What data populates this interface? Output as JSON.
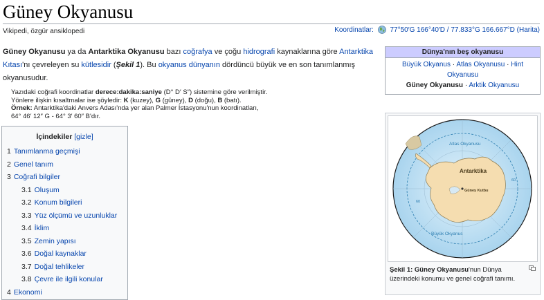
{
  "page": {
    "title": "Güney Okyanusu",
    "tagline": "Vikipedi, özgür ansiklopedi"
  },
  "coordinates": {
    "label": "Koordinatlar:",
    "value": "77°50′G 166°40′D / 77.833°G 166.667°D (Harita)"
  },
  "intro": {
    "t1": "Güney Okyanusu",
    "t2": " ya da ",
    "t3": "Antarktika Okyanusu",
    "t4": " bazı ",
    "l1": "coğrafya",
    "t5": " ve çoğu ",
    "l2": "hidrografi",
    "t6": " kaynaklarına göre ",
    "l3": "Antarktika Kıtası",
    "t7": "'nı çevreleyen su ",
    "l4": "kütlesidir",
    "t8": " (",
    "t9": "Şekil 1",
    "t10": "). Bu ",
    "l5": "okyanus dünyanın",
    "t11": " dördüncü büyük ve en son tanımlanmış okyanusudur."
  },
  "coord_note": {
    "a1": "Yazıdaki coğrafi koordinatlar ",
    "a2": "derece:dakika:saniye",
    "a3": " (D° D′ S″) sistemine göre verilmiştir.",
    "b1": "Yönlere ilişkin kısaltmalar ise şöyledir: ",
    "b2": "K",
    "b3": " (kuzey), ",
    "b4": "G",
    "b5": " (güney), ",
    "b6": "D",
    "b7": " (doğu), ",
    "b8": "B",
    "b9": " (batı).",
    "c1": "Örnek:",
    "c2": " Antarktika'daki Anvers Adası'nda yer alan Palmer İstasyonu'nun koordinatları,",
    "c3": "64° 46′ 12″ G - 64° 3′ 60″ B'dır."
  },
  "toc": {
    "title": "İçindekiler",
    "toggle": "[gizle]",
    "items": [
      {
        "num": "1",
        "label": "Tanımlanma geçmişi"
      },
      {
        "num": "2",
        "label": "Genel tanım"
      },
      {
        "num": "3",
        "label": "Coğrafi bilgiler"
      },
      {
        "num": "3.1",
        "label": "Oluşum"
      },
      {
        "num": "3.2",
        "label": "Konum bilgileri"
      },
      {
        "num": "3.3",
        "label": "Yüz ölçümü ve uzunluklar"
      },
      {
        "num": "3.4",
        "label": "İklim"
      },
      {
        "num": "3.5",
        "label": "Zemin yapısı"
      },
      {
        "num": "3.6",
        "label": "Doğal kaynaklar"
      },
      {
        "num": "3.7",
        "label": "Doğal tehlikeler"
      },
      {
        "num": "3.8",
        "label": "Çevre ile ilgili konular"
      },
      {
        "num": "4",
        "label": "Ekonomi"
      }
    ]
  },
  "navbox": {
    "title": "Dünya'nın beş okyanusu",
    "items": [
      "Büyük Okyanus",
      "Atlas Okyanusu",
      "Hint Okyanusu",
      "Güney Okyanusu",
      "Arktik Okyanusu"
    ],
    "sep": " · "
  },
  "figure": {
    "map_labels": {
      "atlantic": "Atlas Okyanusu",
      "antarctica": "Antarktika",
      "pole": "Güney Kutbu",
      "pacific": "Büyük Okyanus",
      "lat_left": "60",
      "lat_right": "60"
    },
    "caption_bold": "Şekil 1: Güney Okyanusu",
    "caption_rest": "'nun Dünya üzerindeki konumu ve genel coğrafi tanımı.",
    "colors": {
      "ocean": "#c4e4f4",
      "land": "#f5ddb0",
      "border": "#2b7db0"
    }
  }
}
